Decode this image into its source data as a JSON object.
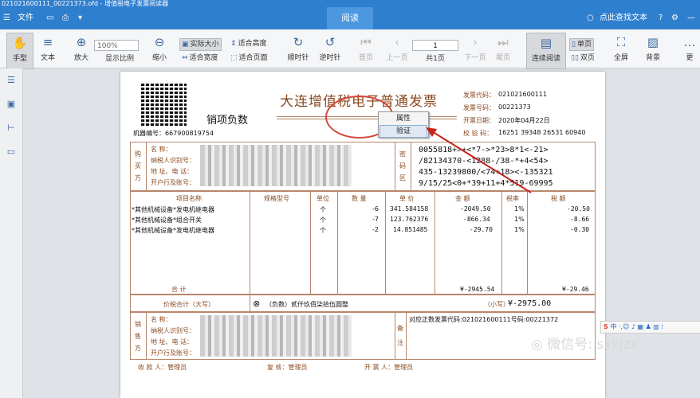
{
  "window": {
    "title": "021021600111_00221373.ofd - 增值税电子发票阅读器"
  },
  "menu": {
    "file": "文件",
    "tab_read": "阅读",
    "search_placeholder": "点此查找文本"
  },
  "toolbar": {
    "hand": "手型",
    "text": "文本",
    "zoom_in": "放大",
    "zoom_value": "100%",
    "zoom_ratio": "显示比例",
    "zoom_out": "缩小",
    "actual_size": "实际大小",
    "fit_height": "适合高度",
    "fit_width": "适合宽度",
    "fit_page": "适合页面",
    "rotate_cw": "顺时针",
    "rotate_ccw": "逆时针",
    "first": "首页",
    "prev": "上一页",
    "page_value": "1",
    "page_total": "共1页",
    "next": "下一页",
    "last": "尾页",
    "continuous": "连续阅读",
    "single": "单页",
    "double": "双页",
    "fullscreen": "全屏",
    "background": "背景",
    "more": "更"
  },
  "context_menu": {
    "item1": "属性",
    "item2": "验证"
  },
  "invoice": {
    "title": "大连增值税电子普通发票",
    "negative": "销项负数",
    "machine_no": "机器编号：667900819754",
    "code_label": "发票代码：",
    "code": "021021600111",
    "num_label": "发票号码：",
    "num": "00221373",
    "date_label": "开票日期：",
    "date": "2020年04月22日",
    "check_label": "校 验 码：",
    "check": "16251 39348 26531 60940",
    "buyer_side": "购买方",
    "buyer_labels": [
      "名 称：",
      "纳税人识别号：",
      "地 址、电 话：",
      "开户行及账号："
    ],
    "password_label": "密码区",
    "password_lines": [
      "0055818+>+<*7->*23>8*1<-21>",
      "/82134370-<1288-/38-*+4<54>",
      "435-13239800/<74+18><-135321",
      "9/15/25<0+*39+11+4*519-69995"
    ],
    "headers": [
      "项目名称",
      "规格型号",
      "单位",
      "数 量",
      "单 价",
      "金 额",
      "税率",
      "税 额"
    ],
    "items": [
      {
        "name": "*其他机械设备*发电机继电器",
        "unit": "个",
        "qty": "-6",
        "price": "341.584158",
        "amount": "-2049.50",
        "rate": "1%",
        "tax": "-20.50"
      },
      {
        "name": "*其他机械设备*组合开关",
        "unit": "个",
        "qty": "-7",
        "price": "123.762376",
        "amount": "-866.34",
        "rate": "1%",
        "tax": "-8.66"
      },
      {
        "name": "*其他机械设备*发电机继电器",
        "unit": "个",
        "qty": "-2",
        "price": "14.851485",
        "amount": "-29.70",
        "rate": "1%",
        "tax": "-0.30"
      }
    ],
    "total_label": "合 计",
    "total_amount": "¥-2945.54",
    "total_tax": "¥-29.46",
    "sum_label": "价税合计（大写）",
    "sum_upper": "（负数）贰仟玖佰柒拾伍圆整",
    "sum_small_label": "（小写）",
    "sum_small": "¥-2975.00",
    "seller_side": "销售方",
    "seller_labels": [
      "名 称：",
      "纳税人识别号：",
      "地 址、电 话：",
      "开户行及账号："
    ],
    "remark_label": "备注",
    "remark": "对应正数发票代码:021021600111号码:00221372",
    "payee": "收 款 人：管理员",
    "reviewer": "复 核：管理员",
    "drawer": "开 票 人：管理员"
  },
  "watermark": "微信号: sxkjzx",
  "ime": "中"
}
